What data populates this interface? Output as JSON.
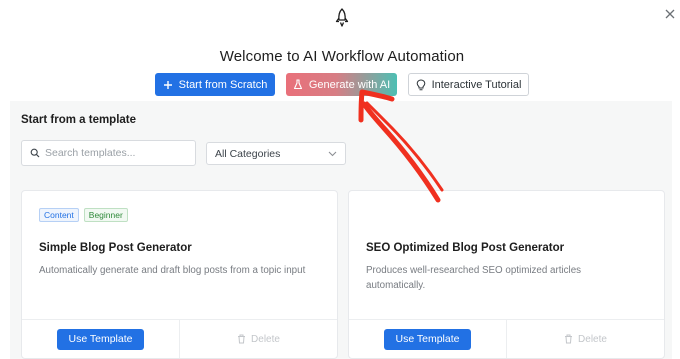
{
  "header": {
    "title": "Welcome to AI Workflow Automation",
    "logo_icon": "rocket-icon",
    "close_icon": "close-icon"
  },
  "actions": {
    "start_scratch": "Start from Scratch",
    "generate_ai": "Generate with AI",
    "tutorial": "Interactive Tutorial"
  },
  "templates": {
    "section_title": "Start from a template",
    "search_placeholder": "Search templates...",
    "category_selected": "All Categories",
    "cards": [
      {
        "badges": [
          "Content",
          "Beginner"
        ],
        "title": "Simple Blog Post Generator",
        "description": "Automatically generate and draft blog posts from a topic input",
        "use_label": "Use Template",
        "delete_label": "Delete"
      },
      {
        "badges": [],
        "title": "SEO Optimized Blog Post Generator",
        "description": "Produces well-researched SEO optimized articles automatically.",
        "use_label": "Use Template",
        "delete_label": "Delete"
      }
    ]
  },
  "colors": {
    "primary": "#2271e4",
    "annotation_arrow": "#f0301f",
    "gradient_start": "#e9707a",
    "gradient_end": "#4dbfb3"
  }
}
